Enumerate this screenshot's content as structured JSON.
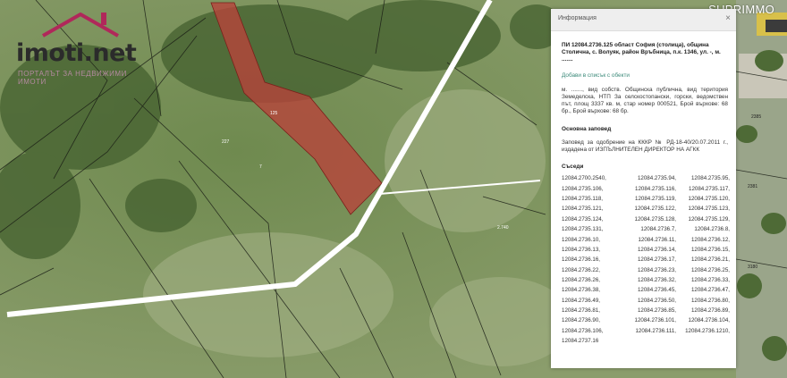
{
  "brand": "SUPRIMMO",
  "logo": {
    "text": "imoti.net",
    "tagline": "ПОРТАЛЪТ ЗА НЕДВИЖИМИ ИМОТИ",
    "accent_color": "#b0285a"
  },
  "map": {
    "parcel_color": "#b9433b",
    "road_color": "#ffffff",
    "parcel_labels": [
      "125",
      "227",
      "7"
    ],
    "plot_labels": [
      "2.740",
      "2385",
      "2381",
      "3180"
    ]
  },
  "panel": {
    "title": "Информация",
    "close_icon": "×",
    "property_title": "ПИ 12084.2736.125 област София (столица), община Столична, с. Волуяк, район Връбница, п.к. 1346, ул. -, м. .......",
    "add_link": "Добави в списък с обекти",
    "description": "м. ......., вид собств. Общинска публична, вид територия Земеделска, НТП За селскостопански, горски, ведомствен път, площ 3337 кв. м, стар номер 000521, Брой върхове: 68 бр., Брой върхове: 68 бр.",
    "order_heading": "Основна заповед",
    "order_text": "Заповед за одобрение на КККР № РД-18-40/20.07.2011 г., издадена от ИЗПЪЛНИТЕЛЕН ДИРЕКТОР НА АГКК",
    "neighbors_heading": "Съседи",
    "neighbors": [
      "12084.2700.2540,",
      "12084.2735.94,",
      "12084.2735.95,",
      "12084.2735.106,",
      "12084.2735.116,",
      "12084.2735.117,",
      "12084.2735.118,",
      "12084.2735.119,",
      "12084.2735.120,",
      "12084.2735.121,",
      "12084.2735.122,",
      "12084.2735.123,",
      "12084.2735.124,",
      "12084.2735.128,",
      "12084.2735.129,",
      "12084.2735.131,",
      "12084.2736.7,",
      "12084.2736.8,",
      "12084.2736.10,",
      "12084.2736.11,",
      "12084.2736.12,",
      "12084.2736.13,",
      "12084.2736.14,",
      "12084.2736.15,",
      "12084.2736.16,",
      "12084.2736.17,",
      "12084.2736.21,",
      "12084.2736.22,",
      "12084.2736.23,",
      "12084.2736.25,",
      "12084.2736.26,",
      "12084.2736.32,",
      "12084.2736.33,",
      "12084.2736.38,",
      "12084.2736.45,",
      "12084.2736.47,",
      "12084.2736.49,",
      "12084.2736.50,",
      "12084.2736.80,",
      "12084.2736.81,",
      "12084.2736.85,",
      "12084.2736.89,",
      "12084.2736.90,",
      "12084.2736.101,",
      "12084.2736.104,",
      "12084.2736.106,",
      "12084.2736.111,",
      "12084.2736.1210,",
      "12084.2737.16"
    ]
  }
}
